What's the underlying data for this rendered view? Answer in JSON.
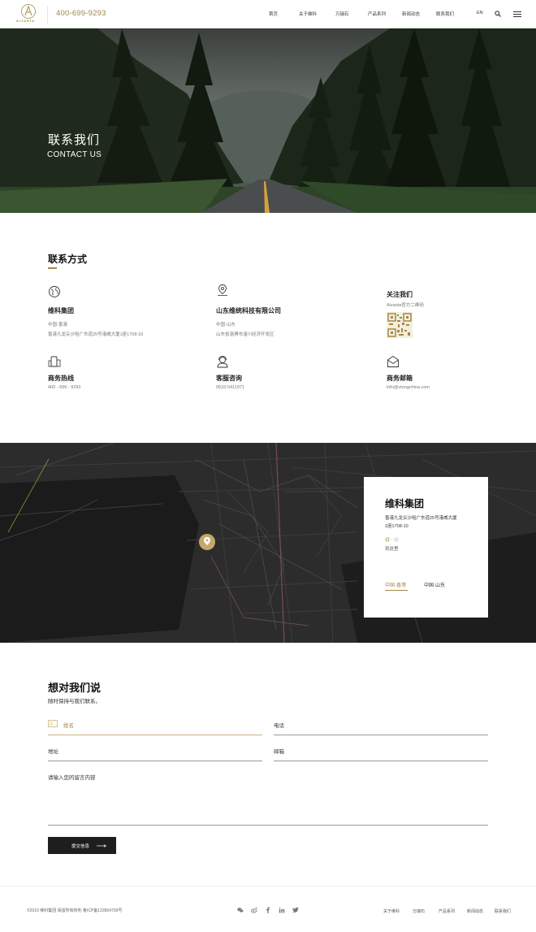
{
  "header": {
    "logo_text": "ALVANTA",
    "phone": "400-699-9293",
    "nav": [
      "首页",
      "关于维科",
      "万瑞石",
      "产品系列",
      "新闻动态",
      "联系我们",
      "EN"
    ]
  },
  "banner": {
    "title": "联系我们",
    "subtitle": "CONTACT US"
  },
  "contact": {
    "title": "联系方式",
    "items": [
      {
        "icon": "globe-icon",
        "name": "维科集团",
        "line1": "中国·香港",
        "line2": "香港九龙尖沙咀广东道25号港威大厦1座1708-10"
      },
      {
        "icon": "location-pin-icon",
        "name": "山东维统科技有限公司",
        "line1": "中国·山东",
        "line2": "山东省淄博市淄川经济开发区"
      },
      {
        "icon": "qr-code-icon",
        "name": "关注我们",
        "line1": "Alvanta官方二维码",
        "line2": ""
      },
      {
        "icon": "phone-icon",
        "name": "商务热线",
        "line1": "400 - 699 - 9293",
        "line2": ""
      },
      {
        "icon": "customer-service-icon",
        "name": "客服咨询",
        "line1": "0533-5411971",
        "line2": ""
      },
      {
        "icon": "mail-icon",
        "name": "商务邮箱",
        "line1": "info@vtongchina.com",
        "line2": ""
      }
    ]
  },
  "map": {
    "card_title": "维科集团",
    "address_line1": "香港九龙尖沙咀广东道25号港威大厦",
    "address_line2": "1座1708-10",
    "goto": "到这里",
    "tabs": [
      "中国·香港",
      "中国·山东"
    ],
    "active_tab": 0
  },
  "form": {
    "title": "想对我们说",
    "subtitle": "随时保持与我们联系。",
    "fields": {
      "name": "姓名",
      "phone": "电话",
      "address": "地址",
      "email": "邮箱",
      "message": "请输入您的留言内容"
    },
    "submit": "提交信息"
  },
  "footer": {
    "copyright": "©2019 维科集团 保留所有权利 鲁ICP备123564709号",
    "links": [
      "关于维科",
      "万瑞石",
      "产品系列",
      "新闻动态",
      "联系我们"
    ],
    "social_icons": [
      "wechat-icon",
      "weibo-icon",
      "facebook-icon",
      "linkedin-icon",
      "twitter-icon"
    ]
  },
  "colors": {
    "accent": "#a38845",
    "dark": "#1e1e1e",
    "map_bg": "#2b2b2b"
  }
}
